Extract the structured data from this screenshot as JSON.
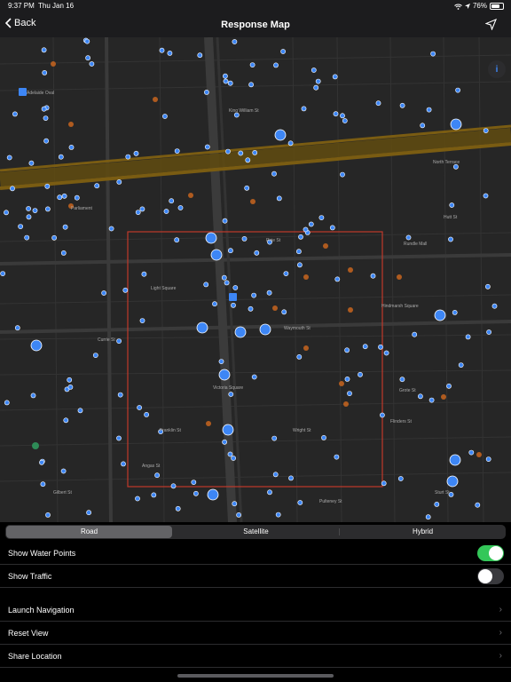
{
  "status": {
    "time": "9:37 PM",
    "date": "Thu Jan 16",
    "battery": "76%"
  },
  "nav": {
    "back_label": "Back",
    "title": "Response Map",
    "locate_icon": "location-arrow-icon"
  },
  "map": {
    "info_icon": "info-icon",
    "labels": [
      "Parliament",
      "Adelaide Oval",
      "North Terrace",
      "Rundle Mall",
      "Grote St",
      "King William St",
      "Pirie St",
      "Currie St",
      "Waymouth St",
      "Light Square",
      "Hindmarsh Square",
      "Victoria Square",
      "Franklin St",
      "Flinders St",
      "Wright St",
      "Angas St",
      "Gilbert St",
      "Sturt St",
      "Hutt St",
      "Pulteney St"
    ],
    "colors": {
      "water_point": "#3d86f5",
      "boundary": "#c0392b",
      "trunk_road": "#7a5c12"
    }
  },
  "map_type": {
    "options": [
      "Road",
      "Satellite",
      "Hybrid"
    ],
    "selected": "Road"
  },
  "settings": {
    "show_water_points": {
      "label": "Show Water Points",
      "on": true
    },
    "show_traffic": {
      "label": "Show Traffic",
      "on": false
    },
    "actions": [
      {
        "label": "Launch Navigation"
      },
      {
        "label": "Reset View"
      },
      {
        "label": "Share Location"
      }
    ]
  }
}
